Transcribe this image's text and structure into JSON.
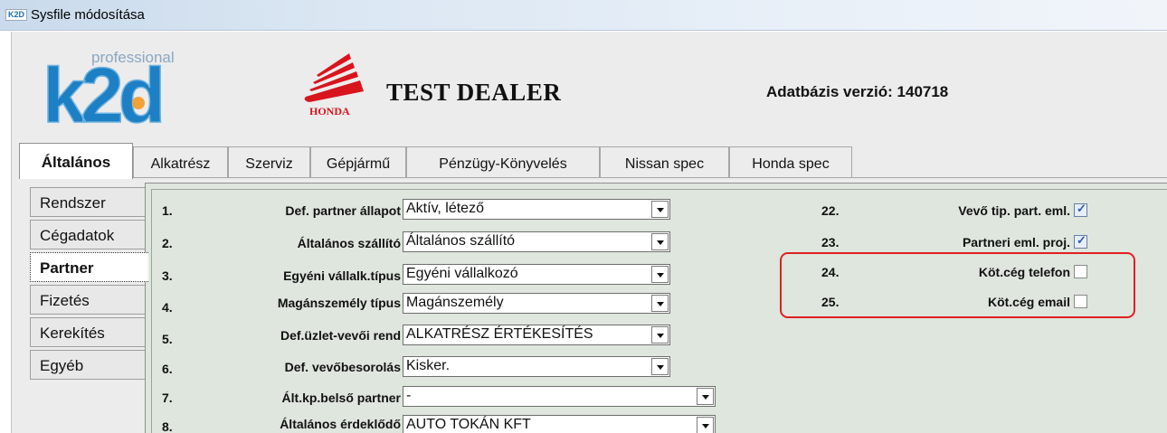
{
  "window": {
    "title": "Sysfile módosítása",
    "icon_text": "K2D"
  },
  "header": {
    "logo_small_text": "professional",
    "logo_text": "k2d",
    "brand_text": "HONDA",
    "dealer_name": "TEST DEALER",
    "db_version": "Adatbázis verzió: 140718"
  },
  "top_tabs": [
    "Általános",
    "Alkatrész",
    "Szerviz",
    "Gépjármű",
    "Pénzügy-Könyvelés",
    "Nissan spec",
    "Honda spec"
  ],
  "side_tabs": [
    "Rendszer",
    "Cégadatok",
    "Partner",
    "Fizetés",
    "Kerekítés",
    "Egyéb"
  ],
  "rows": [
    {
      "num": "1.",
      "label": "Def. partner állapot",
      "value": "Aktív, létező"
    },
    {
      "num": "2.",
      "label": "Általános szállító",
      "value": "Általános szállító"
    },
    {
      "num": "3.",
      "label": "Egyéni vállalk.típus",
      "value": "Egyéni vállalkozó"
    },
    {
      "num": "4.",
      "label": "Magánszemély típus",
      "value": "Magánszemély"
    },
    {
      "num": "5.",
      "label": "Def.üzlet-vevői rend",
      "value": "ALKATRÉSZ ÉRTÉKESÍTÉS"
    },
    {
      "num": "6.",
      "label": "Def. vevőbesorolás",
      "value": "Kisker."
    },
    {
      "num": "7.",
      "label": "Ált.kp.belső partner",
      "value": "-"
    },
    {
      "num": "8.",
      "label": "Általános érdeklődő",
      "value": "AUTO TOKÁN KFT"
    }
  ],
  "right_rows": [
    {
      "num": "22.",
      "label": "Vevő tip. part. eml.",
      "checked": true
    },
    {
      "num": "23.",
      "label": "Partneri eml. proj.",
      "checked": true
    },
    {
      "num": "24.",
      "label": "Köt.cég telefon",
      "checked": false
    },
    {
      "num": "25.",
      "label": "Köt.cég email",
      "checked": false
    }
  ],
  "colors": {
    "panel_bg": "#dee6dd",
    "highlight": "#e02020",
    "logo_blue": "#1d7fc4",
    "honda_red": "#d8141d"
  }
}
